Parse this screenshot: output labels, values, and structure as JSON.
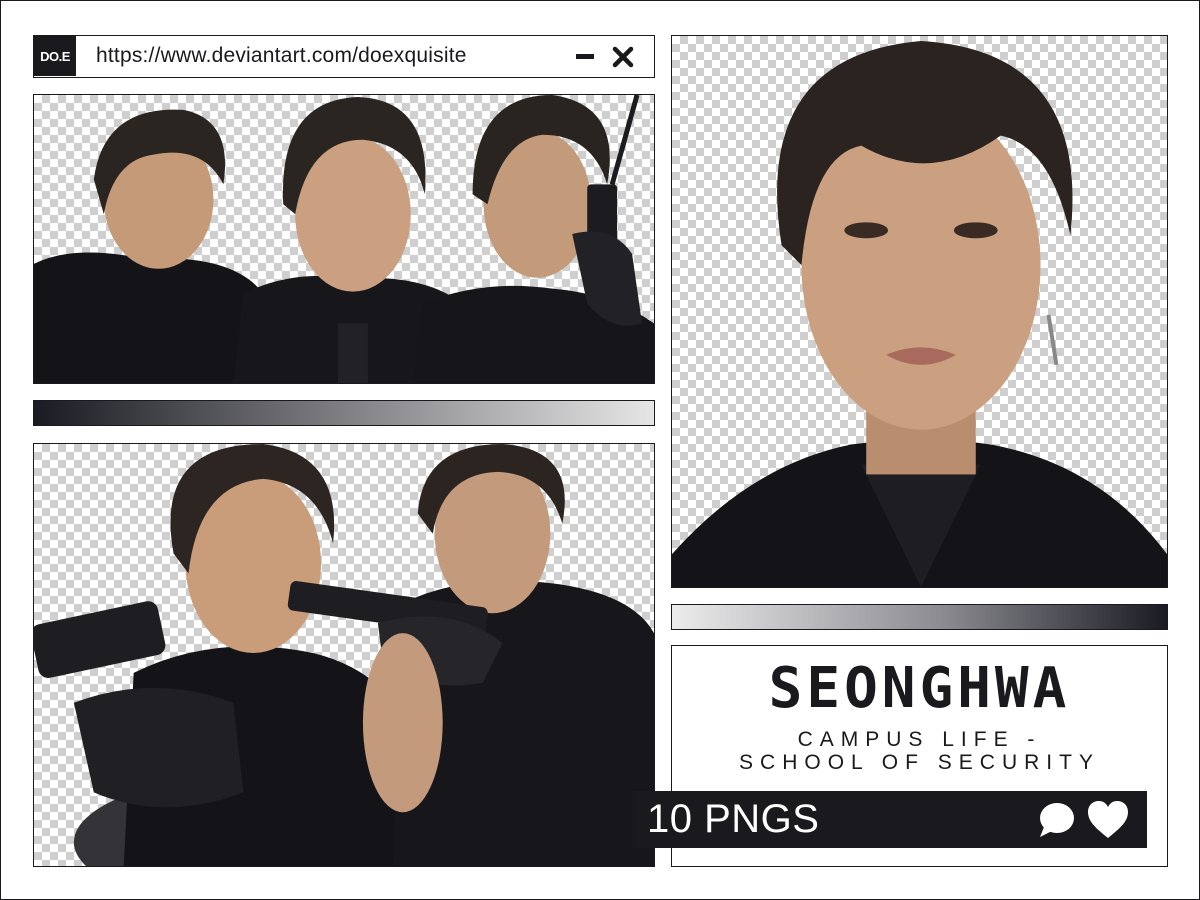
{
  "header": {
    "logo_text": "DO.E",
    "url": "https://www.deviantart.com/doexquisite",
    "minimize_icon": "minimize-icon",
    "close_icon": "close-icon"
  },
  "photos": [
    {
      "name": "collage-top-left",
      "content": "three-portraits"
    },
    {
      "name": "collage-bottom-left",
      "content": "two-portraits"
    },
    {
      "name": "portrait-right",
      "content": "single-portrait"
    }
  ],
  "title_card": {
    "title": "SEONGHWA",
    "subtitle_line1": "CAMPUS LIFE -",
    "subtitle_line2": "SCHOOL OF SECURITY",
    "png_count": "10 PNGS",
    "comment_icon": "comment-icon",
    "heart_icon": "heart-icon"
  },
  "colors": {
    "ink": "#1a1a1e",
    "checker": "#cfcfcf",
    "background": "#ffffff"
  }
}
